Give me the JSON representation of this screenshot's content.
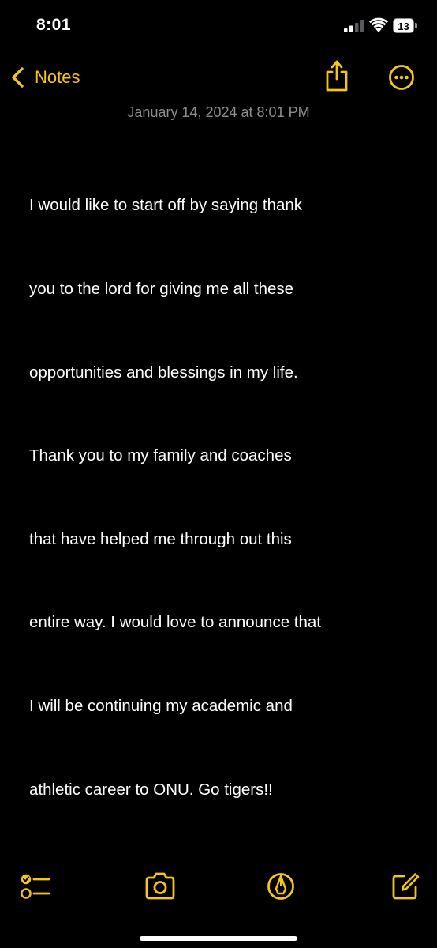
{
  "status_bar": {
    "time": "8:01",
    "battery": "13"
  },
  "nav": {
    "back_label": "Notes"
  },
  "note": {
    "date": "January 14, 2024 at 8:01 PM",
    "lines": [
      "I would like to start off by saying thank",
      "you to the lord for giving me all these",
      "opportunities and blessings in my life.",
      "Thank you to my family and coaches",
      "that have helped me through out this",
      "entire way. I would love to announce that",
      "I will be continuing my academic and",
      "athletic career to ONU. Go tigers!!"
    ]
  },
  "icons": {
    "back": "chevron-left-icon",
    "share": "share-icon",
    "more": "ellipsis-circle-icon",
    "checklist": "checklist-icon",
    "camera": "camera-icon",
    "markup": "markup-pen-icon",
    "compose": "compose-icon"
  },
  "colors": {
    "accent": "#f5c518",
    "background": "#000000",
    "secondary_text": "#8e8e93"
  }
}
